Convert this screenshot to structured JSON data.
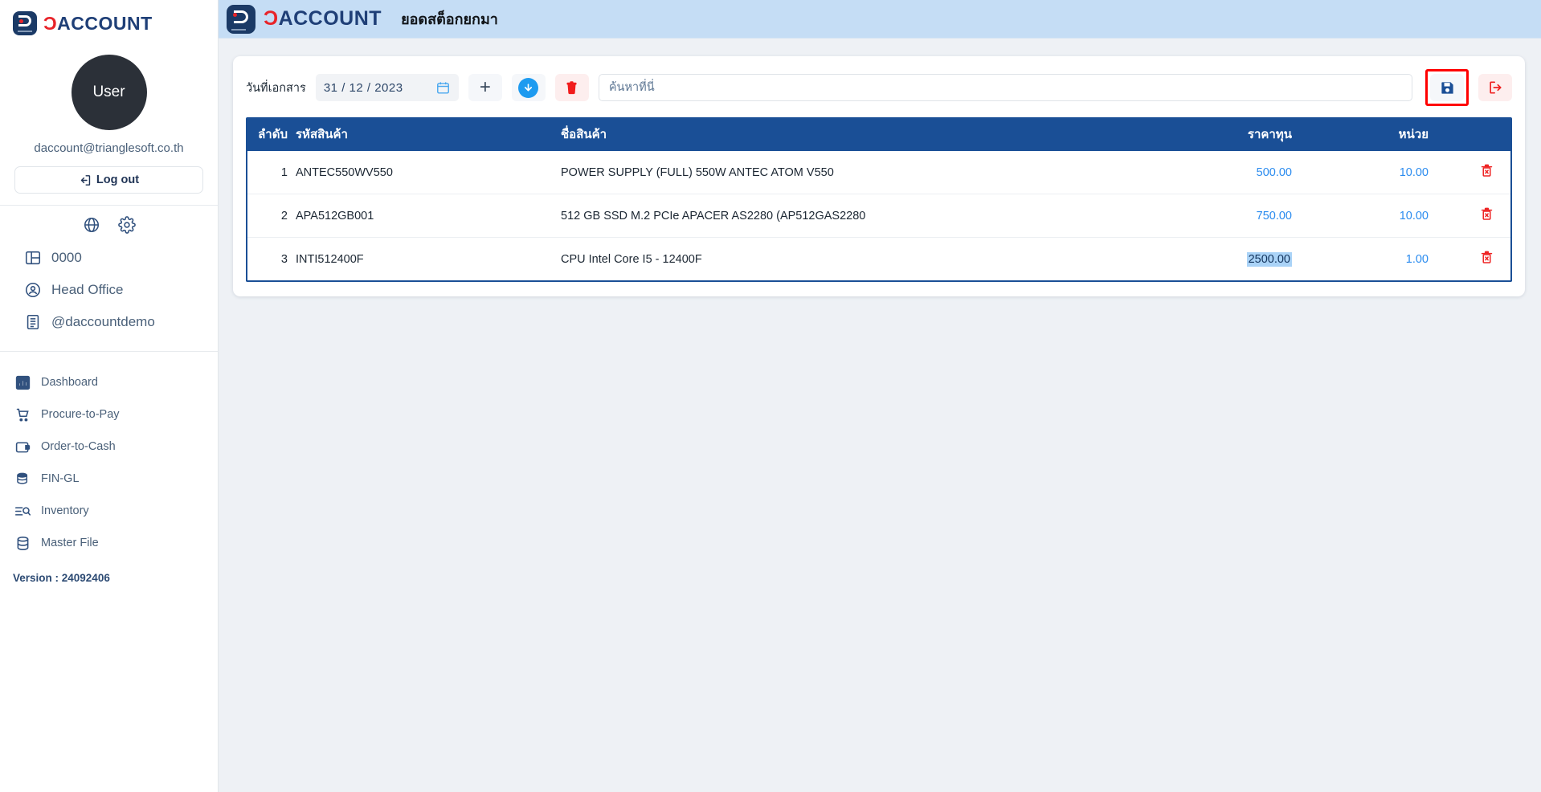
{
  "brand": {
    "word_red": "Ɔ",
    "word_blue": "ACCOUNT",
    "logo_name": "daccount-logo"
  },
  "sidebar": {
    "avatar_label": "User",
    "email": "daccount@trianglesoft.co.th",
    "logout_label": "Log out",
    "quick_icons": [
      {
        "name": "globe-icon"
      },
      {
        "name": "gear-icon"
      }
    ],
    "info_items": [
      {
        "icon": "panel-icon",
        "label": "0000"
      },
      {
        "icon": "user-circle-icon",
        "label": "Head Office"
      },
      {
        "icon": "document-icon",
        "label": "@daccountdemo"
      }
    ],
    "nav_items": [
      {
        "icon": "dashboard-icon",
        "label": "Dashboard"
      },
      {
        "icon": "cart-icon",
        "label": "Procure-to-Pay"
      },
      {
        "icon": "wallet-icon",
        "label": "Order-to-Cash"
      },
      {
        "icon": "coins-icon",
        "label": "FIN-GL"
      },
      {
        "icon": "inventory-icon",
        "label": "Inventory"
      },
      {
        "icon": "database-icon",
        "label": "Master File"
      }
    ],
    "version": "Version : 24092406"
  },
  "header": {
    "title": "ยอดสต็อกยกมา"
  },
  "toolbar": {
    "date_label": "วันที่เอกสาร",
    "date_value": "31 / 12 / 2023",
    "calendar_icon": "calendar-icon",
    "add_label": "+",
    "download_icon": "download-icon",
    "delete_icon": "trash-icon",
    "save_icon": "save-icon",
    "exit_icon": "exit-icon"
  },
  "search": {
    "placeholder": "ค้นหาที่นี่",
    "value": ""
  },
  "table": {
    "columns": {
      "seq": "ลำดับ",
      "code": "รหัสสินค้า",
      "name": "ชื่อสินค้า",
      "cost": "ราคาทุน",
      "unit": "หน่วย"
    },
    "rows": [
      {
        "seq": "1",
        "code": "ANTEC550WV550",
        "name": "POWER SUPPLY (FULL) 550W ANTEC ATOM V550",
        "cost": "500.00",
        "unit": "10.00",
        "selected": false
      },
      {
        "seq": "2",
        "code": "APA512GB001",
        "name": "512 GB SSD M.2 PCIe APACER AS2280 (AP512GAS2280",
        "cost": "750.00",
        "unit": "10.00",
        "selected": false
      },
      {
        "seq": "3",
        "code": "INTI512400F",
        "name": "CPU Intel Core I5 - 12400F",
        "cost": "2500.00",
        "unit": "1.00",
        "selected": true
      }
    ]
  },
  "colors": {
    "table_header_bg": "#1a4f96",
    "topbar_bg": "#c5ddf5",
    "accent_blue": "#2a8bef",
    "danger_red": "#ef3b3b",
    "highlight_red": "#ff0000",
    "selection_bg": "#aad3f7"
  }
}
